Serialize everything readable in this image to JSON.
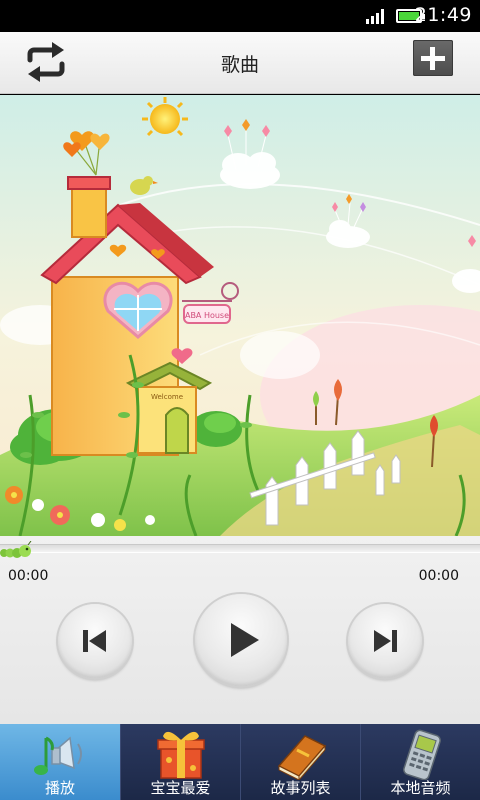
{
  "status_bar": {
    "time": "21:49"
  },
  "title_bar": {
    "title": "歌曲"
  },
  "artwork": {
    "sign_text": "ABA House",
    "door_text": "Welcome"
  },
  "player": {
    "elapsed": "00:00",
    "duration": "00:00",
    "progress": 0
  },
  "tabs": [
    {
      "label": "播放",
      "icon": "speaker-note-icon",
      "active": true
    },
    {
      "label": "宝宝最爱",
      "icon": "gift-box-icon",
      "active": false
    },
    {
      "label": "故事列表",
      "icon": "book-icon",
      "active": false
    },
    {
      "label": "本地音频",
      "icon": "phone-icon",
      "active": false
    }
  ]
}
